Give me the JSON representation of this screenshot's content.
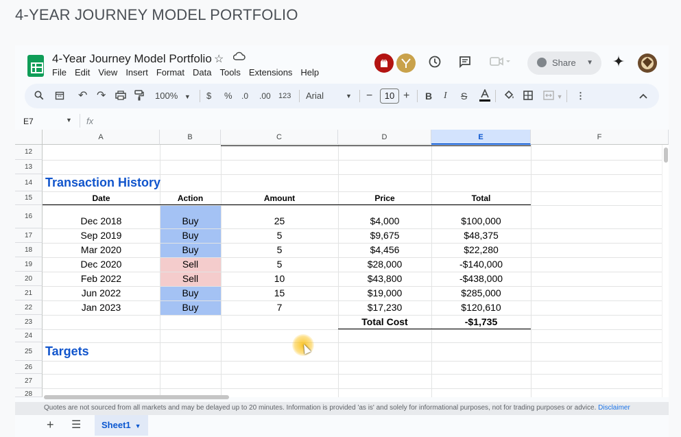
{
  "page_title": "4-YEAR JOURNEY MODEL PORTFOLIO",
  "app": {
    "doc_title": "4-Year Journey Model Portfolio",
    "menu": [
      "File",
      "Edit",
      "View",
      "Insert",
      "Format",
      "Data",
      "Tools",
      "Extensions",
      "Help"
    ],
    "share_label": "Share",
    "icons": [
      "star-icon",
      "cloud-status-icon",
      "history-icon",
      "comment-icon",
      "meet-icon",
      "gemini-icon"
    ],
    "colors": {
      "accent": "#0b57d0",
      "sheets_green": "#0f9d58",
      "buy_fill": "#a4c2f4",
      "sell_fill": "#f4cccc",
      "section_title": "#1155cc"
    }
  },
  "toolbar": {
    "zoom": "100%",
    "currency": "$",
    "percent": "%",
    "dec_decrease": ".0",
    "dec_increase": ".00",
    "number_format": "123",
    "font": "Arial",
    "font_size": "10",
    "bold": "B",
    "italic": "I",
    "minus": "−",
    "plus": "+"
  },
  "formula_bar": {
    "name_box": "E7",
    "fx": "fx",
    "value": ""
  },
  "grid": {
    "columns": [
      "A",
      "B",
      "C",
      "D",
      "E",
      "F"
    ],
    "selected_column": "E",
    "rows": [
      "12",
      "13",
      "14",
      "15",
      "16",
      "17",
      "18",
      "19",
      "20",
      "21",
      "22",
      "23",
      "24",
      "25",
      "26",
      "27",
      "28"
    ],
    "transaction_title": "Transaction History",
    "headers": [
      "Date",
      "Action",
      "Amount",
      "Price",
      "Total"
    ],
    "transactions": [
      {
        "date": "Dec 2018",
        "action": "Buy",
        "amount": "25",
        "price": "$4,000",
        "total": "$100,000"
      },
      {
        "date": "Sep 2019",
        "action": "Buy",
        "amount": "5",
        "price": "$9,675",
        "total": "$48,375"
      },
      {
        "date": "Mar 2020",
        "action": "Buy",
        "amount": "5",
        "price": "$4,456",
        "total": "$22,280"
      },
      {
        "date": "Dec 2020",
        "action": "Sell",
        "amount": "5",
        "price": "$28,000",
        "total": "-$140,000"
      },
      {
        "date": "Feb 2022",
        "action": "Sell",
        "amount": "10",
        "price": "$43,800",
        "total": "-$438,000"
      },
      {
        "date": "Jun 2022",
        "action": "Buy",
        "amount": "15",
        "price": "$19,000",
        "total": "$285,000"
      },
      {
        "date": "Jan 2023",
        "action": "Buy",
        "amount": "7",
        "price": "$17,230",
        "total": "$120,610"
      }
    ],
    "total_cost_label": "Total Cost",
    "total_cost_value": "-$1,735",
    "targets_title": "Targets"
  },
  "disclaimer": {
    "text": "Quotes are not sourced from all markets and may be delayed up to 20 minutes. Information is provided 'as is' and solely for informational purposes, not for trading purposes or advice.",
    "link": "Disclaimer"
  },
  "tabs": {
    "sheet_name": "Sheet1"
  }
}
